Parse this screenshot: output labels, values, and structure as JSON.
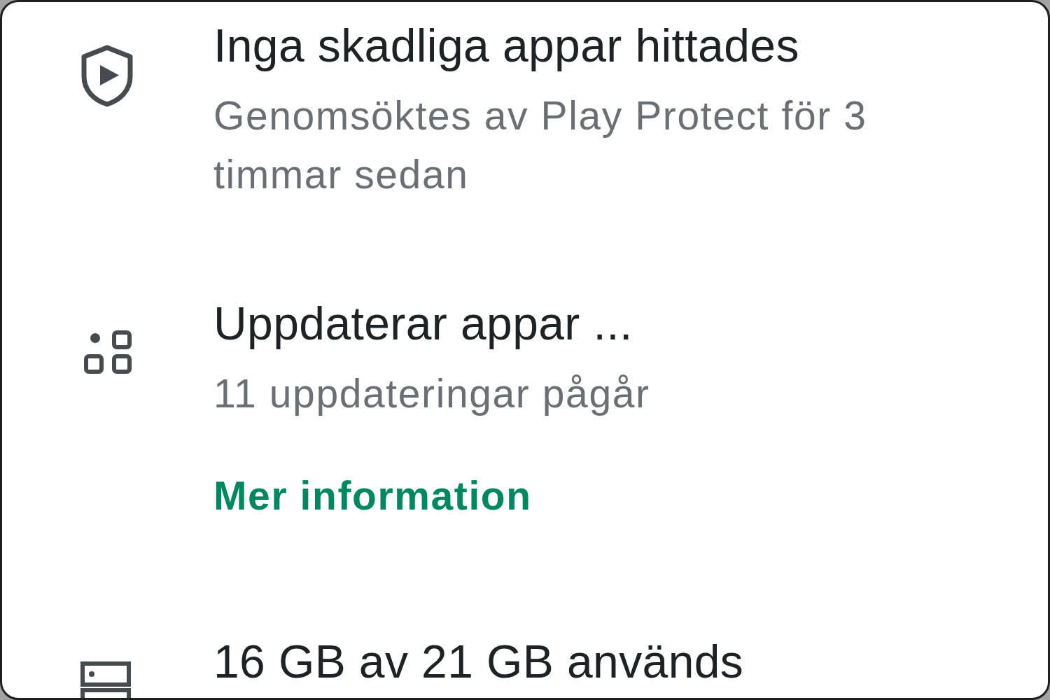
{
  "items": [
    {
      "kind": "protect",
      "title": "Inga skadliga appar hittades",
      "subtitle": "Genomsöktes av Play Protect för 3 timmar sedan"
    },
    {
      "kind": "updates",
      "title": "Uppdaterar appar ...",
      "subtitle": "11 uppdateringar pågår",
      "link": "Mer information"
    },
    {
      "kind": "storage",
      "title": "16 GB av 21 GB används"
    }
  ]
}
